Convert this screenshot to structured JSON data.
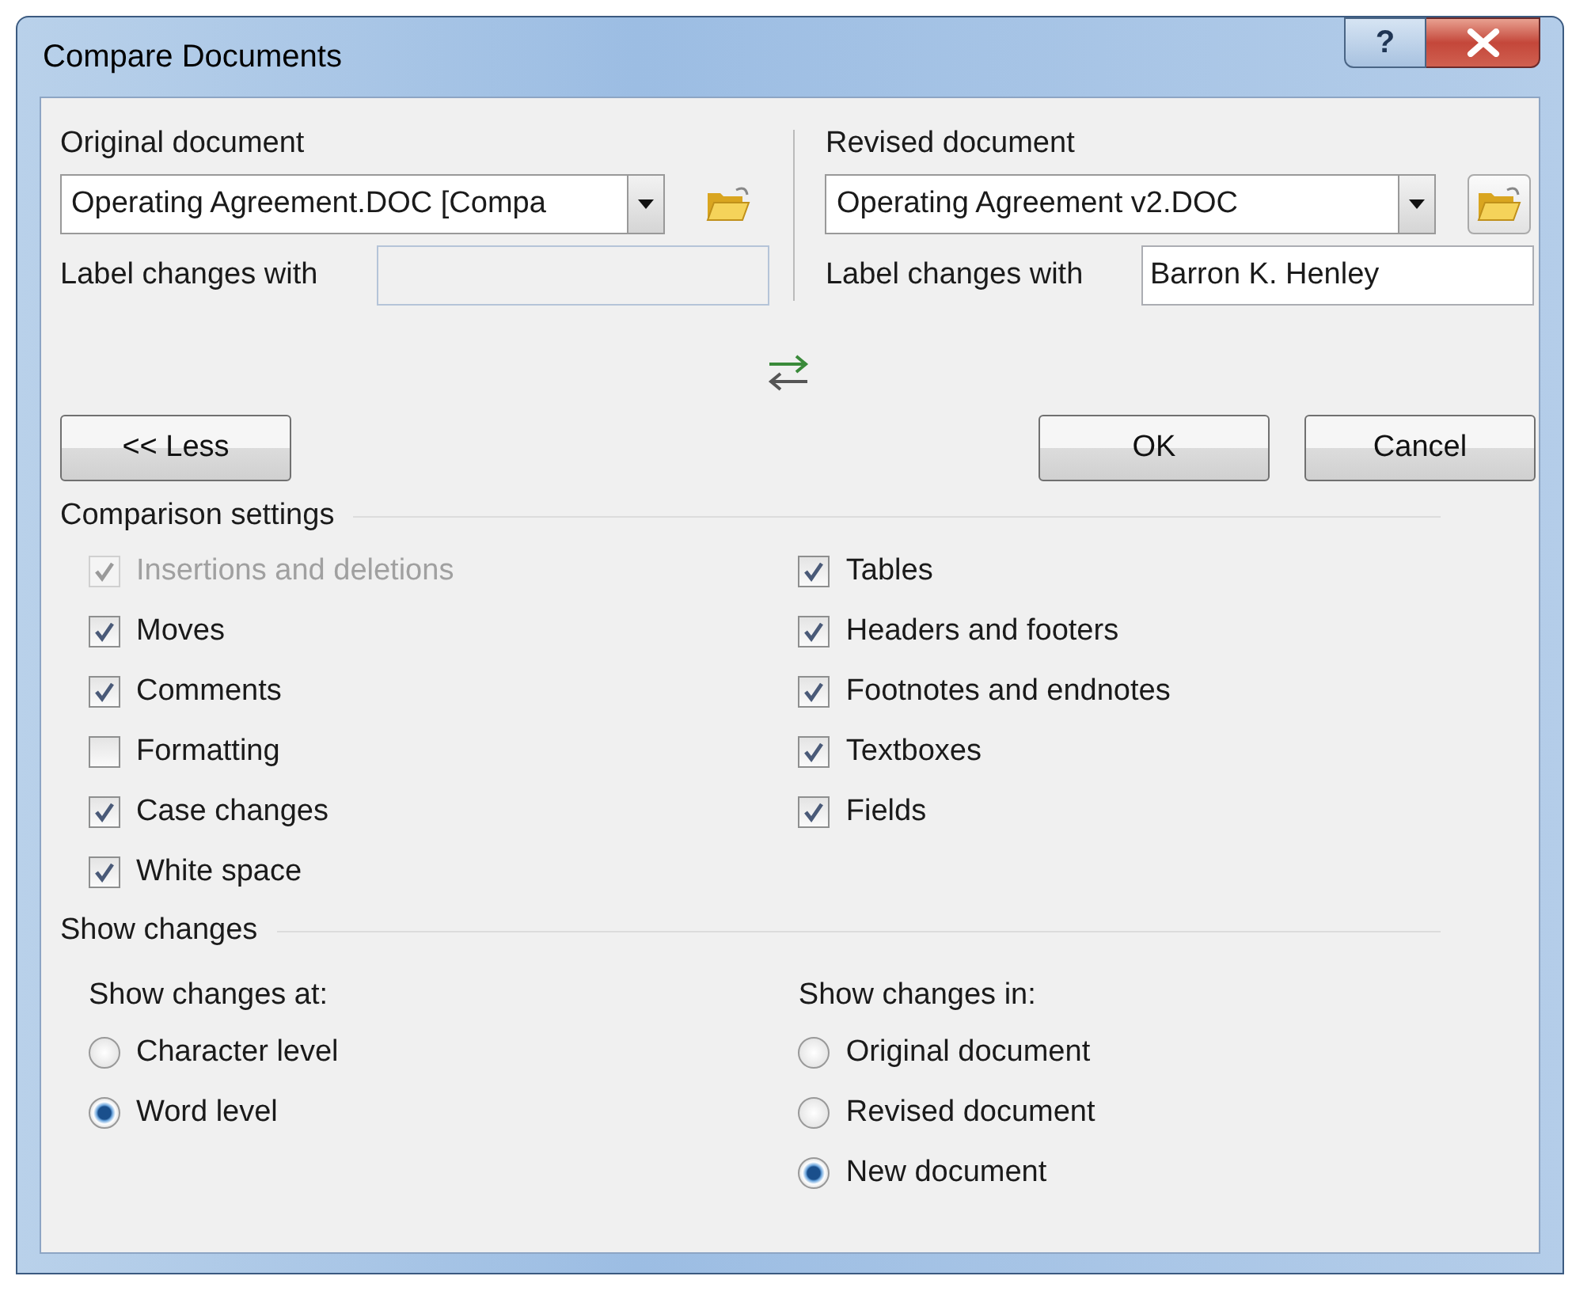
{
  "window": {
    "title": "Compare Documents",
    "help": "?"
  },
  "original": {
    "label": "Original document",
    "value": "Operating Agreement.DOC [Compa",
    "label_changes": {
      "label": "Label changes with",
      "disabled": true
    }
  },
  "revised": {
    "label": "Revised document",
    "value": "Operating Agreement v2.DOC",
    "label_changes": {
      "label": "Label changes with",
      "value": "Barron K. Henley",
      "disabled": false
    }
  },
  "buttons": {
    "less": "<< Less",
    "ok": "OK",
    "cancel": "Cancel"
  },
  "comparison_settings": {
    "title": "Comparison settings",
    "left": [
      {
        "label": "Insertions and deletions",
        "checked": true,
        "disabled": true
      },
      {
        "label": "Moves",
        "checked": true,
        "disabled": false
      },
      {
        "label": "Comments",
        "checked": true,
        "disabled": false
      },
      {
        "label": "Formatting",
        "checked": false,
        "disabled": false
      },
      {
        "label": "Case changes",
        "checked": true,
        "disabled": false
      },
      {
        "label": "White space",
        "checked": true,
        "disabled": false
      }
    ],
    "right": [
      {
        "label": "Tables",
        "checked": true,
        "disabled": false
      },
      {
        "label": "Headers and footers",
        "checked": true,
        "disabled": false
      },
      {
        "label": "Footnotes and endnotes",
        "checked": true,
        "disabled": false
      },
      {
        "label": "Textboxes",
        "checked": true,
        "disabled": false
      },
      {
        "label": "Fields",
        "checked": true,
        "disabled": false
      }
    ]
  },
  "show_changes": {
    "title": "Show changes",
    "at": {
      "label": "Show changes at:",
      "options": [
        {
          "label": "Character level",
          "selected": false
        },
        {
          "label": "Word level",
          "selected": true
        }
      ]
    },
    "in": {
      "label": "Show changes in:",
      "options": [
        {
          "label": "Original document",
          "selected": false
        },
        {
          "label": "Revised document",
          "selected": false
        },
        {
          "label": "New document",
          "selected": true
        }
      ]
    }
  }
}
